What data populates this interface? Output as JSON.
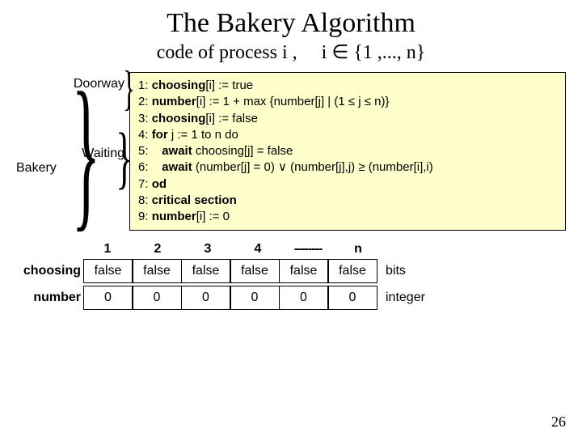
{
  "title": "The Bakery Algorithm",
  "subtitle_prefix": "code of process i ,",
  "subtitle_suffix": "i ∈ {1 ,..., n}",
  "labels": {
    "doorway": "Doorway",
    "waiting": "Waiting",
    "bakery": "Bakery"
  },
  "code": {
    "l1p": "1: ",
    "l1k": "choosing",
    "l1r": "[i] := true",
    "l2p": "2: ",
    "l2k": "number",
    "l2r": "[i] := 1 + max {number[j] | (1 ≤ j ≤ n)}",
    "l3p": "3: ",
    "l3k": "choosing",
    "l3r": "[i] := false",
    "l4p": "4: ",
    "l4k": "for",
    "l4r": " j := 1 to n do",
    "l5p": "5:    ",
    "l5k": "await",
    "l5r": " choosing[j] = false",
    "l6p": "6:    ",
    "l6k": "await",
    "l6r": " (number[j] = 0) ∨ (number[j],j) ≥ (number[i],i)",
    "l7p": "7: ",
    "l7k": "od",
    "l7r": "",
    "l8p": "8: ",
    "l8k": "critical section",
    "l8r": "",
    "l9p": "9: ",
    "l9k": "number",
    "l9r": "[i] := 0"
  },
  "table": {
    "headers": [
      "1",
      "2",
      "3",
      "4",
      "--------",
      "n"
    ],
    "row1_label": "choosing",
    "row1": [
      "false",
      "false",
      "false",
      "false",
      "false",
      "false"
    ],
    "row1_type": "bits",
    "row2_label": "number",
    "row2": [
      "0",
      "0",
      "0",
      "0",
      "0",
      "0"
    ],
    "row2_type": "integer"
  },
  "page": "26"
}
